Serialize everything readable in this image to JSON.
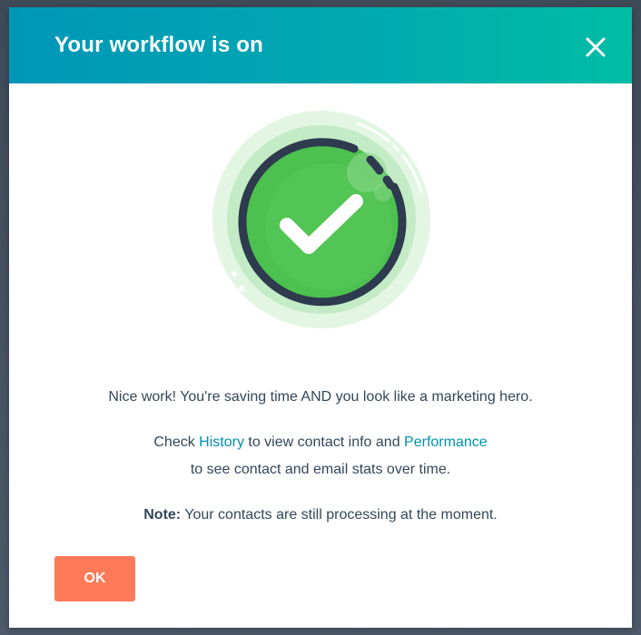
{
  "modal": {
    "title": "Your workflow is on",
    "close_icon": "close-icon",
    "hero_icon": "checkmark-success-icon",
    "message_1": "Nice work! You're saving time AND you look like a marketing hero.",
    "message_2": {
      "prefix": "Check ",
      "history_link": "History",
      "middle": " to view contact info and ",
      "performance_link": "Performance",
      "suffix": " to see contact and email stats over time."
    },
    "note": {
      "label": "Note:",
      "text": " Your contacts are still processing at the moment."
    },
    "ok_label": "OK"
  },
  "colors": {
    "header_start": "#0096b8",
    "header_end": "#00bda5",
    "text": "#33475b",
    "link": "#0091ae",
    "primary_button": "#ff7a59",
    "success_green": "#4cc14f",
    "ring_dark": "#2e3a4d"
  }
}
